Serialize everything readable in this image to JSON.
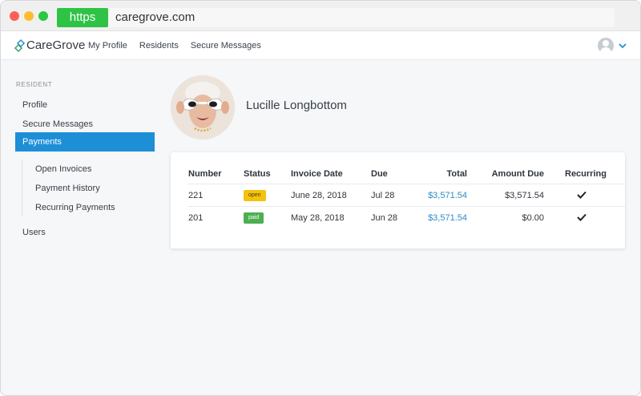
{
  "browser": {
    "protocol": "https",
    "url": "caregrove.com"
  },
  "header": {
    "brand": "CareGrove",
    "nav": [
      "My Profile",
      "Residents",
      "Secure Messages"
    ]
  },
  "sidebar": {
    "section_label": "RESIDENT",
    "items": [
      {
        "label": "Profile"
      },
      {
        "label": "Secure Messages"
      },
      {
        "label": "Payments"
      }
    ],
    "sub_items": [
      {
        "label": "Open Invoices"
      },
      {
        "label": "Payment History"
      },
      {
        "label": "Recurring Payments"
      }
    ],
    "bottom_item": {
      "label": "Users"
    }
  },
  "resident": {
    "name": "Lucille Longbottom"
  },
  "invoices": {
    "headers": {
      "number": "Number",
      "status": "Status",
      "invoice_date": "Invoice Date",
      "due": "Due",
      "total": "Total",
      "amount_due": "Amount Due",
      "recurring": "Recurring"
    },
    "rows": [
      {
        "number": "221",
        "status": "open",
        "invoice_date": "June 28, 2018",
        "due": "Jul 28",
        "total": "$3,571.54",
        "amount_due": "$3,571.54",
        "recurring": true
      },
      {
        "number": "201",
        "status": "paid",
        "invoice_date": "May 28, 2018",
        "due": "Jun 28",
        "total": "$3,571.54",
        "amount_due": "$0.00",
        "recurring": true
      }
    ]
  },
  "colors": {
    "accent": "#1d8fd6",
    "link": "#2e8bc9",
    "status_open": "#f4c20d",
    "status_paid": "#4caf50",
    "protocol_badge": "#2ec345"
  },
  "icons": [
    "caregrove-logo-icon",
    "user-avatar-icon",
    "chevron-down-icon",
    "checkmark-icon"
  ]
}
